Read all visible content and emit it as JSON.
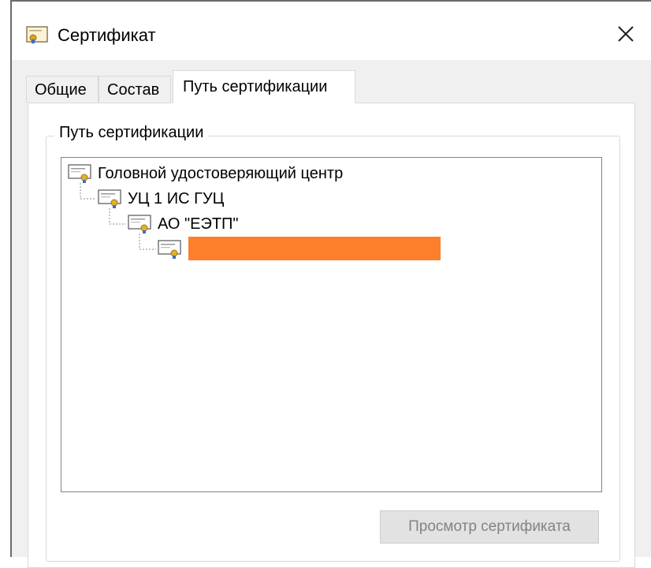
{
  "window": {
    "title": "Сертификат",
    "close_icon": "close-icon"
  },
  "tabs": [
    {
      "label": "Общие",
      "active": false
    },
    {
      "label": "Состав",
      "active": false
    },
    {
      "label": "Путь сертификации",
      "active": true
    }
  ],
  "path_group": {
    "label": "Путь сертификации",
    "nodes": [
      {
        "label": "Головной удостоверяющий центр",
        "level": 0
      },
      {
        "label": "УЦ 1 ИС ГУЦ",
        "level": 1
      },
      {
        "label": "АО \"ЕЭТП\"",
        "level": 2
      },
      {
        "label": "",
        "level": 3,
        "redacted": true,
        "redaction_color": "#fd7f2c"
      }
    ]
  },
  "buttons": {
    "view_certificate": "Просмотр сертификата"
  }
}
